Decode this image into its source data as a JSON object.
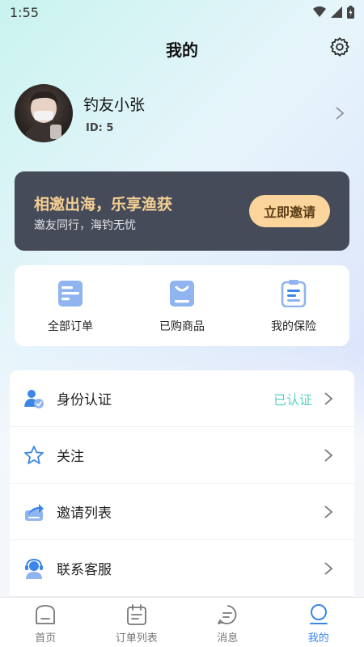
{
  "status_bar": {
    "time": "1:55"
  },
  "header": {
    "title": "我的"
  },
  "profile": {
    "name": "钓友小张",
    "id_text": "ID: 5"
  },
  "invite": {
    "title": "相邀出海，乐享渔获",
    "subtitle": "邀友同行，海钓无忧",
    "button_label": "立即邀请"
  },
  "quick_actions": [
    {
      "label": "全部订单",
      "icon": "orders-icon"
    },
    {
      "label": "已购商品",
      "icon": "purchased-goods-icon"
    },
    {
      "label": "我的保险",
      "icon": "insurance-icon"
    }
  ],
  "menu": [
    {
      "label": "身份认证",
      "value": "已认证",
      "icon": "identity-verify-icon"
    },
    {
      "label": "关注",
      "value": "",
      "icon": "star-icon"
    },
    {
      "label": "邀请列表",
      "value": "",
      "icon": "invite-share-icon"
    },
    {
      "label": "联系客服",
      "value": "",
      "icon": "customer-service-icon"
    }
  ],
  "bottom_nav": [
    {
      "label": "首页",
      "icon": "home-icon"
    },
    {
      "label": "订单列表",
      "icon": "calendar-list-icon"
    },
    {
      "label": "消息",
      "icon": "message-icon"
    },
    {
      "label": "我的",
      "icon": "profile-icon",
      "active": true
    }
  ],
  "colors": {
    "accent": "#3b86e6",
    "verified": "#5ad1c4",
    "banner": "#464b59",
    "banner_title": "#f3cf92",
    "banner_button": "#fbd59b"
  }
}
